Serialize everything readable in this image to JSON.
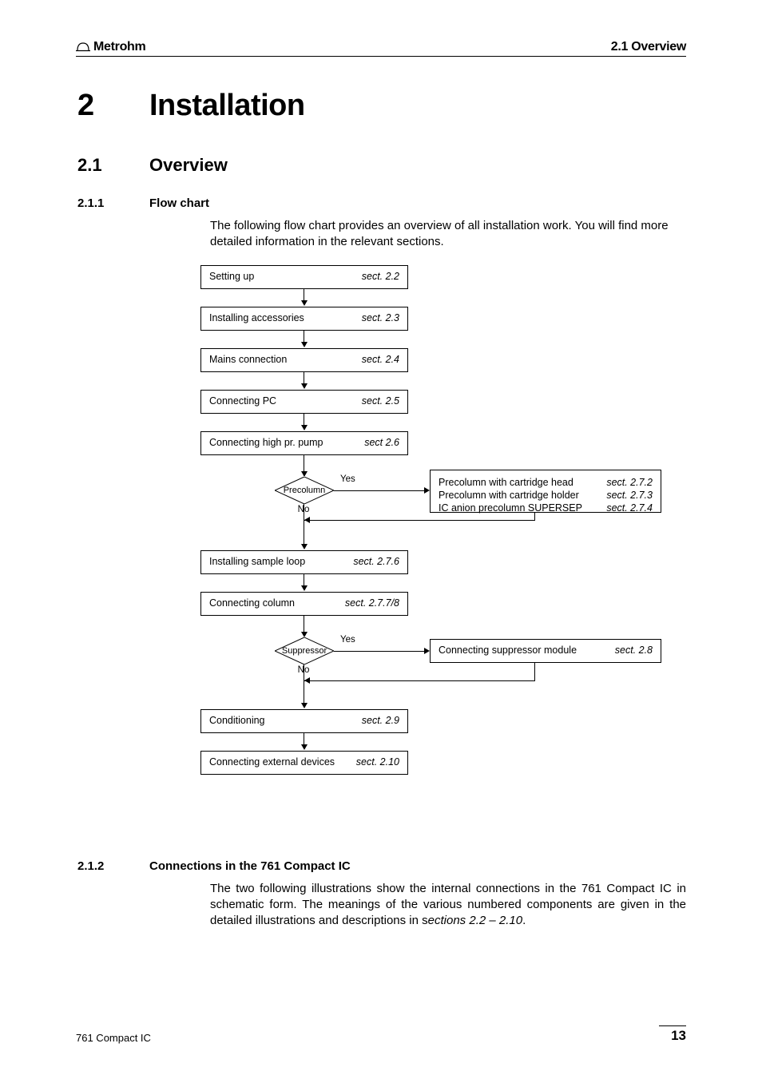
{
  "header": {
    "brand": "Metrohm",
    "right": "2.1 Overview"
  },
  "chapter": {
    "number": "2",
    "title": "Installation"
  },
  "section": {
    "number": "2.1",
    "title": "Overview"
  },
  "sub1": {
    "number": "2.1.1",
    "title": "Flow chart",
    "intro": "The following flow chart provides an overview of all installation work. You will find more detailed information in the relevant sections."
  },
  "flow": {
    "b1": {
      "label": "Setting up",
      "ref": "sect. 2.2"
    },
    "b2": {
      "label": "Installing accessories",
      "ref": "sect. 2.3"
    },
    "b3": {
      "label": "Mains connection",
      "ref": "sect. 2.4"
    },
    "b4": {
      "label": "Connecting PC",
      "ref": "sect. 2.5"
    },
    "b5": {
      "label": "Connecting high pr. pump",
      "ref": "sect 2.6"
    },
    "d1": {
      "label": "Precolumn",
      "yes": "Yes",
      "no": "No"
    },
    "side1": {
      "l1": "Precolumn with cartridge head",
      "l2": "Precolumn with cartridge holder",
      "l3": "IC anion precolumn SUPERSEP",
      "r1": "sect. 2.7.2",
      "r2": "sect. 2.7.3",
      "r3": "sect. 2.7.4"
    },
    "b6": {
      "label": "Installing sample loop",
      "ref": "sect. 2.7.6"
    },
    "b7": {
      "label": "Connecting column",
      "ref": "sect. 2.7.7/8"
    },
    "d2": {
      "label": "Suppressor",
      "yes": "Yes",
      "no": "No"
    },
    "side2": {
      "label": "Connecting suppressor module",
      "ref": "sect. 2.8"
    },
    "b8": {
      "label": "Conditioning",
      "ref": "sect. 2.9"
    },
    "b9": {
      "label": "Connecting external devices",
      "ref": "sect. 2.10"
    }
  },
  "sub2": {
    "number": "2.1.2",
    "title": "Connections in the 761 Compact IC",
    "para_a": "The two following illustrations show the internal connections in the 761 Compact IC in schematic form. The meanings of the various numbered components are given in the detailed illustrations and descriptions in s",
    "para_b": "ections 2.2 – 2.10",
    "para_c": "."
  },
  "footer": {
    "doc": "761 Compact IC",
    "page": "13"
  }
}
